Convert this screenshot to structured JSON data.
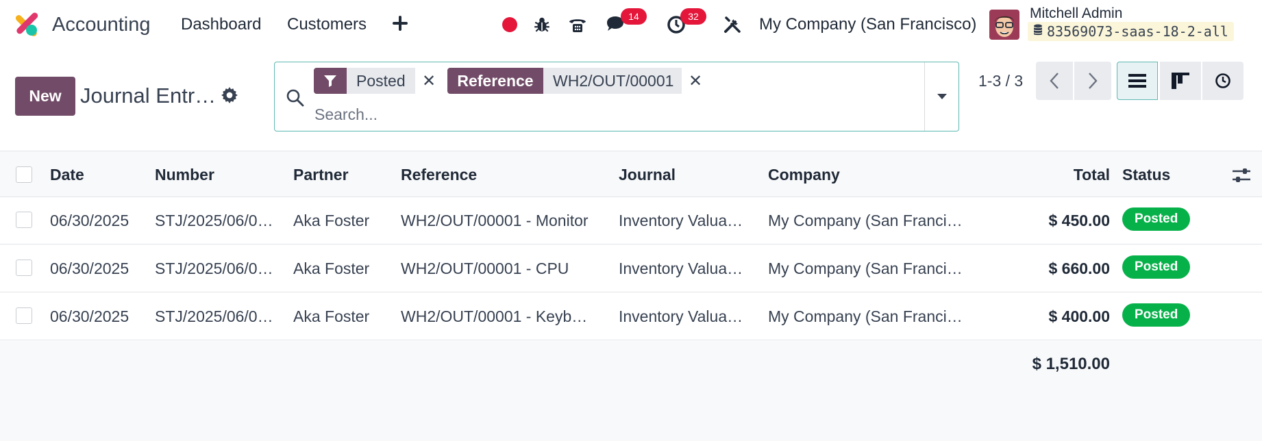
{
  "navbar": {
    "app_name": "Accounting",
    "menu": [
      "Dashboard",
      "Customers"
    ],
    "add_icon": "plus-icon",
    "record_icon": "record-dot-icon",
    "debug_icon": "bug-icon",
    "phone_icon": "phone-icon",
    "messages": {
      "icon": "chat-icon",
      "count": "14"
    },
    "activities": {
      "icon": "clock-icon",
      "count": "32"
    },
    "tools_icon": "tools-icon",
    "company": "My Company (San Francisco)",
    "user_name": "Mitchell Admin",
    "database": "83569073-saas-18-2-all"
  },
  "control": {
    "new_label": "New",
    "title": "Journal Entr…",
    "search": {
      "facets": [
        {
          "icon": "filter-icon",
          "label": "",
          "value": "Posted"
        },
        {
          "icon": "",
          "label": "Reference",
          "value": "WH2/OUT/00001"
        }
      ],
      "placeholder": "Search..."
    },
    "pager": "1-3 / 3",
    "views": [
      "list-view-icon",
      "kanban-view-icon",
      "activity-view-icon"
    ]
  },
  "table": {
    "columns": {
      "date": "Date",
      "number": "Number",
      "partner": "Partner",
      "reference": "Reference",
      "journal": "Journal",
      "company": "Company",
      "total": "Total",
      "status": "Status"
    },
    "rows": [
      {
        "date": "06/30/2025",
        "number": "STJ/2025/06/0…",
        "partner": "Aka Foster",
        "reference": "WH2/OUT/00001 - Monitor",
        "journal": "Inventory Valua…",
        "company": "My Company (San Franci…",
        "total": "$ 450.00",
        "status": "Posted"
      },
      {
        "date": "06/30/2025",
        "number": "STJ/2025/06/0…",
        "partner": "Aka Foster",
        "reference": "WH2/OUT/00001 - CPU",
        "journal": "Inventory Valua…",
        "company": "My Company (San Franci…",
        "total": "$ 660.00",
        "status": "Posted"
      },
      {
        "date": "06/30/2025",
        "number": "STJ/2025/06/0…",
        "partner": "Aka Foster",
        "reference": "WH2/OUT/00001 - Keyb…",
        "journal": "Inventory Valua…",
        "company": "My Company (San Franci…",
        "total": "$ 400.00",
        "status": "Posted"
      }
    ],
    "grand_total": "$ 1,510.00"
  },
  "colors": {
    "brand": "#714b67",
    "accent": "#5cb8b2",
    "posted": "#07b14a",
    "badge": "#e4163a"
  }
}
